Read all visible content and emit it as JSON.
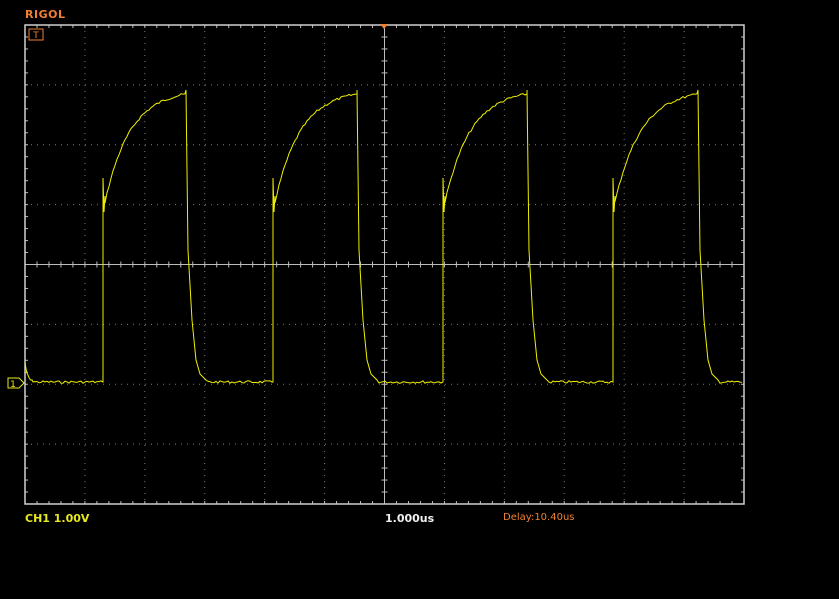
{
  "brand": "RIGOL",
  "trigger_marker": "T",
  "channel_marker": "1",
  "status": {
    "ch1_scale": "CH1 1.00V",
    "timebase": "1.000us",
    "delay": "Delay:10.40us"
  },
  "colors": {
    "background": "#000000",
    "grid": "#8a8a8a",
    "trace": "#f0f000",
    "brand": "#f08030",
    "channel": "#e8e820"
  }
}
